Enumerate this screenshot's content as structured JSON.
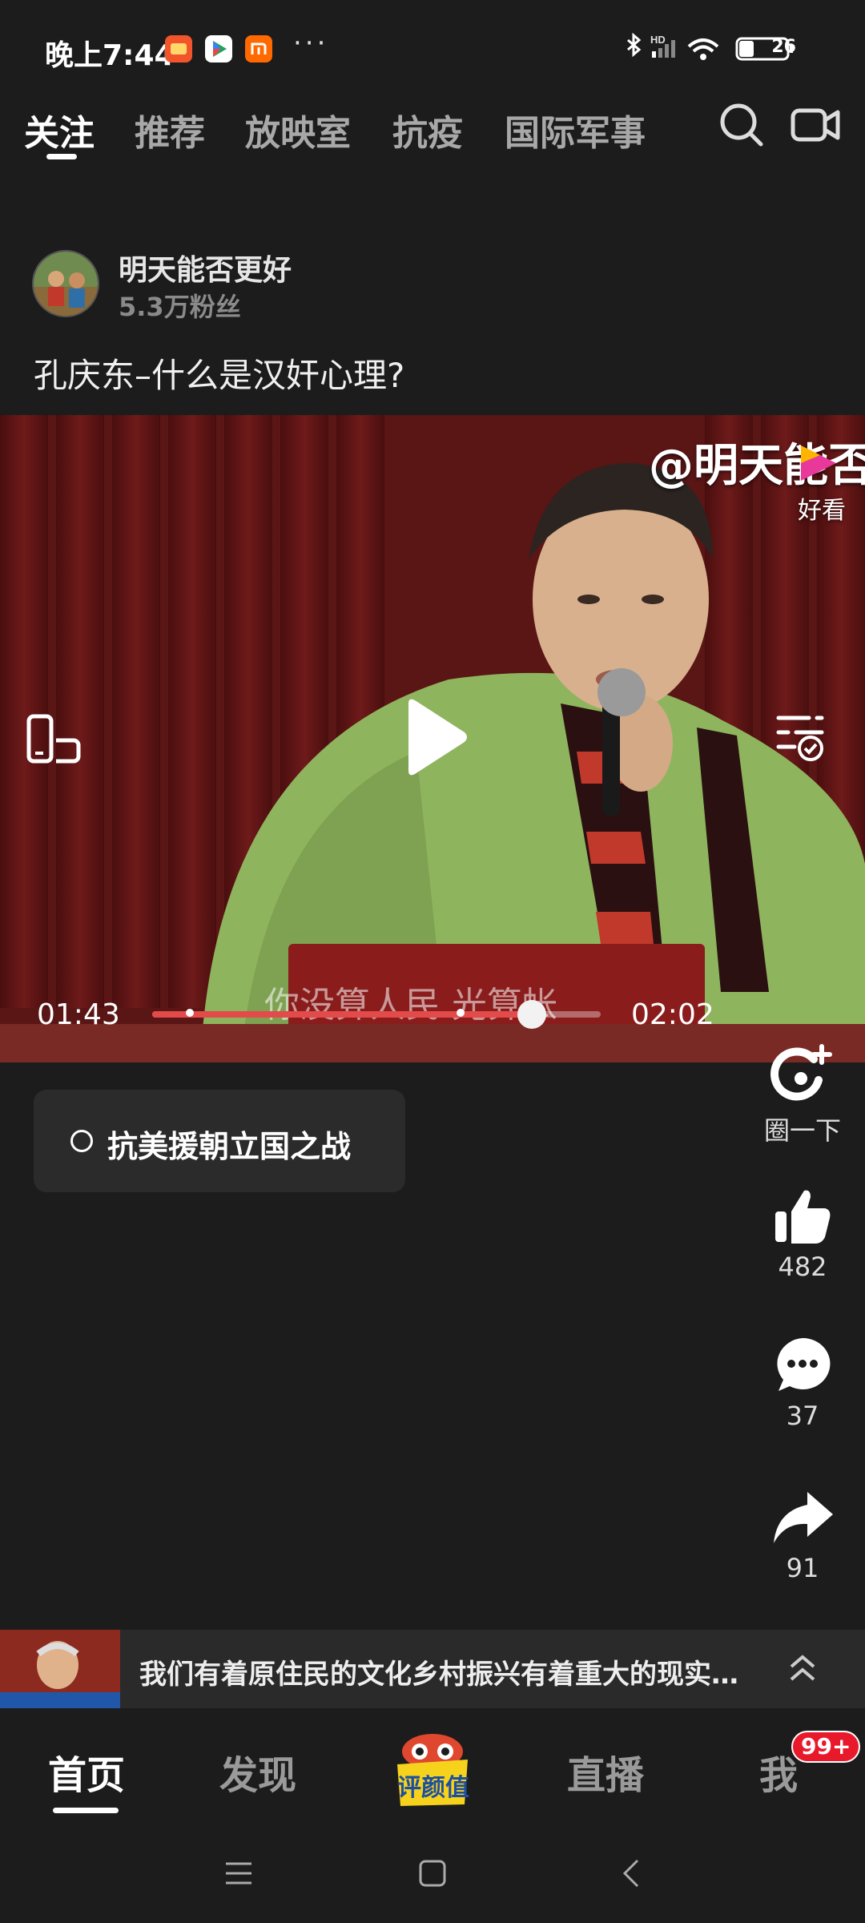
{
  "status_bar": {
    "time": "晚上7:44",
    "battery": "26",
    "network_label": "HD",
    "dots": "···",
    "app_icons": [
      {
        "name": "kuaishou-app-icon",
        "color": "#f2552c",
        "label": "拜年"
      },
      {
        "name": "play-store-icon",
        "color": "#ffffff"
      },
      {
        "name": "mi-app-icon",
        "color": "#ff6900",
        "label": "mi"
      }
    ]
  },
  "top_tabs": {
    "items": [
      {
        "label": "关注",
        "active": true
      },
      {
        "label": "推荐"
      },
      {
        "label": "放映室"
      },
      {
        "label": "抗疫"
      },
      {
        "label": "国际军事"
      }
    ],
    "search_icon": "search-icon",
    "camera_icon": "video-camera-icon"
  },
  "author": {
    "name": "明天能否更好",
    "fans": "5.3万粉丝"
  },
  "post": {
    "title": "孔庆东–什么是汉奸心理?"
  },
  "video": {
    "watermark": "@明天能否",
    "watermark_sub": "好看",
    "subtitle": "你没算人民 光算帐",
    "current_time": "01:43",
    "total_time": "02:02",
    "progress_fraction": 0.846
  },
  "topic": {
    "label": "抗美援朝立国之战"
  },
  "actions": {
    "circle": {
      "label": "圈一下"
    },
    "like": {
      "count": "482"
    },
    "comment": {
      "count": "37"
    },
    "share": {
      "count": "91"
    }
  },
  "related": {
    "text": "我们有着原住民的文化乡村振兴有着重大的现实意义"
  },
  "bottom_nav": {
    "items": [
      {
        "label": "首页",
        "active": true
      },
      {
        "label": "发现"
      },
      {
        "label": "评颜值"
      },
      {
        "label": "直播"
      },
      {
        "label": "我"
      }
    ],
    "badge": "99+"
  },
  "colors": {
    "background": "#1c1c1c",
    "progress": "#e34b4b",
    "badge": "#e9192c"
  }
}
